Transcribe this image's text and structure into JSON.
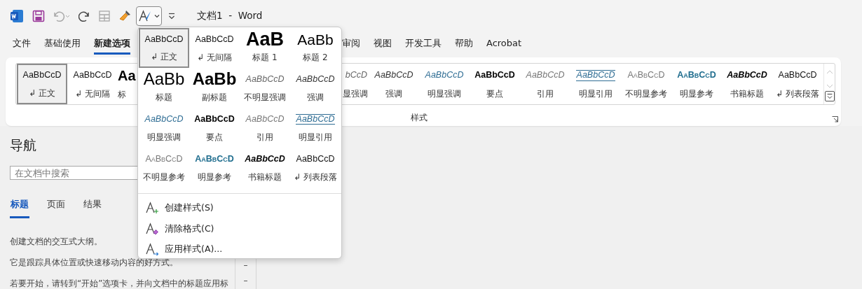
{
  "window": {
    "title": "文档1  -  Word"
  },
  "quick_access": [
    {
      "kind": "save",
      "disabled": false
    },
    {
      "kind": "undo",
      "disabled": true
    },
    {
      "kind": "redo",
      "disabled": false
    },
    {
      "kind": "table",
      "disabled": true
    },
    {
      "kind": "painter",
      "disabled": false
    },
    {
      "kind": "styles",
      "disabled": false
    },
    {
      "kind": "customize",
      "disabled": false
    }
  ],
  "tabs": [
    {
      "label": "文件",
      "selected": false
    },
    {
      "label": "基础使用",
      "selected": false
    },
    {
      "label": "新建选项",
      "selected": true
    },
    {
      "label": "审阅",
      "selected": false
    },
    {
      "label": "视图",
      "selected": false
    },
    {
      "label": "开发工具",
      "selected": false
    },
    {
      "label": "帮助",
      "selected": false
    },
    {
      "label": "Acrobat",
      "selected": false
    }
  ],
  "ribbon_styles": {
    "items": [
      {
        "preview": "AaBbCcD",
        "label": "↲ 正文",
        "kind": "normal",
        "selected": true
      },
      {
        "preview": "AaBbCcD",
        "label": "↲ 无间隔",
        "kind": "normal",
        "selected": false
      },
      {
        "preview": "Aa",
        "label": "标",
        "kind": "heading1",
        "selected": false
      },
      {
        "preview": "bCcD",
        "label": "显强调",
        "kind": "subtle-emphasis",
        "selected": false
      },
      {
        "preview": "AaBbCcD",
        "label": "强调",
        "kind": "emphasis",
        "selected": false
      },
      {
        "preview": "AaBbCcD",
        "label": "明显强调",
        "kind": "intense-emphasis",
        "selected": false
      },
      {
        "preview": "AaBbCcD",
        "label": "要点",
        "kind": "strong",
        "selected": false
      },
      {
        "preview": "AaBbCcD",
        "label": "引用",
        "kind": "quote",
        "selected": false
      },
      {
        "preview": "AaBbCcD",
        "label": "明显引用",
        "kind": "intense-quote",
        "selected": false
      },
      {
        "preview": "AaBbCcD",
        "label": "不明显参考",
        "kind": "subtle-reference",
        "selected": false
      },
      {
        "preview": "AaBbCcD",
        "label": "明显参考",
        "kind": "intense-reference",
        "selected": false
      },
      {
        "preview": "AaBbCcD",
        "label": "书籍标题",
        "kind": "book-title",
        "selected": false
      },
      {
        "preview": "AaBbCcD",
        "label": "↲ 列表段落",
        "kind": "normal",
        "selected": false
      }
    ],
    "group_label": "样式"
  },
  "styles_menu": {
    "items": [
      {
        "preview": "AaBbCcD",
        "label": "↲ 正文",
        "kind": "normal",
        "selected": true
      },
      {
        "preview": "AaBbCcD",
        "label": "↲ 无间隔",
        "kind": "normal",
        "selected": false
      },
      {
        "preview": "AaB",
        "label": "标题 1",
        "kind": "heading1",
        "selected": false
      },
      {
        "preview": "AaBb",
        "label": "标题 2",
        "kind": "heading2",
        "selected": false
      },
      {
        "preview": "AaBb",
        "label": "标题",
        "kind": "title",
        "selected": false
      },
      {
        "preview": "AaBb",
        "label": "副标题",
        "kind": "subtitle",
        "selected": false
      },
      {
        "preview": "AaBbCcD",
        "label": "不明显强调",
        "kind": "subtle-emphasis",
        "selected": false
      },
      {
        "preview": "AaBbCcD",
        "label": "强调",
        "kind": "emphasis",
        "selected": false
      },
      {
        "preview": "AaBbCcD",
        "label": "明显强调",
        "kind": "intense-emphasis",
        "selected": false
      },
      {
        "preview": "AaBbCcD",
        "label": "要点",
        "kind": "strong",
        "selected": false
      },
      {
        "preview": "AaBbCcD",
        "label": "引用",
        "kind": "quote",
        "selected": false
      },
      {
        "preview": "AaBbCcD",
        "label": "明显引用",
        "kind": "intense-quote",
        "selected": false
      },
      {
        "preview": "AaBbCcD",
        "label": "不明显参考",
        "kind": "subtle-reference",
        "selected": false
      },
      {
        "preview": "AaBbCcD",
        "label": "明显参考",
        "kind": "intense-reference",
        "selected": false
      },
      {
        "preview": "AaBbCcD",
        "label": "书籍标题",
        "kind": "book-title",
        "selected": false
      },
      {
        "preview": "AaBbCcD",
        "label": "↲ 列表段落",
        "kind": "normal",
        "selected": false
      }
    ],
    "commands": [
      {
        "kind": "create",
        "label": "创建样式(S)"
      },
      {
        "kind": "clear",
        "label": "清除格式(C)"
      },
      {
        "kind": "apply",
        "label": "应用样式(A)..."
      }
    ]
  },
  "navigation": {
    "title": "导航",
    "search": {
      "placeholder": "在文档中搜索"
    },
    "tabs": [
      {
        "label": "标题",
        "selected": true
      },
      {
        "label": "页面",
        "selected": false
      },
      {
        "label": "结果",
        "selected": false
      }
    ],
    "paragraphs": [
      "创建文档的交互式大纲。",
      "它是跟踪具体位置或快速移动内容的好方式。",
      "若要开始，请转到“开始”选项卡，并向文档中的标题应用标"
    ]
  },
  "ruler_marks": [
    "–",
    "–"
  ]
}
